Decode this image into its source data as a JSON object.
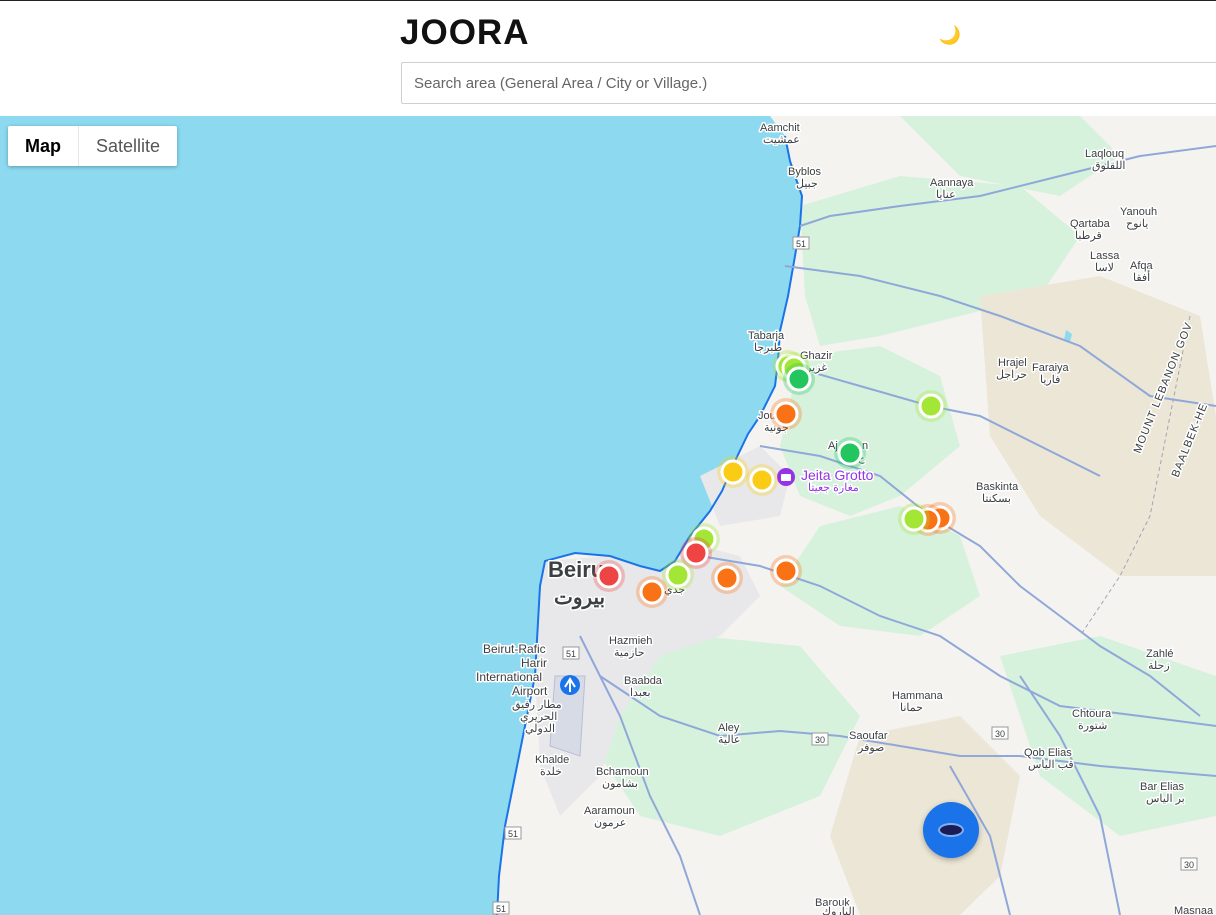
{
  "app": {
    "title": "JOORA",
    "theme_icon": "moon-icon",
    "theme_glyph": "🌙"
  },
  "search": {
    "placeholder": "Search area (General Area / City or Village.)",
    "value": ""
  },
  "map_type": {
    "map_label": "Map",
    "satellite_label": "Satellite",
    "selected": "Map"
  },
  "colors": {
    "water": "#8ddaf0",
    "land": "#f5f3f0",
    "green": "#d6f2dd",
    "urban": "#e8e8ea",
    "hills": "#ece6d6",
    "coast": "#1a73e8",
    "road": "#8fa8d8",
    "marker_red": "#ef4444",
    "marker_orange": "#f97316",
    "marker_yellow": "#facc15",
    "marker_lime": "#a3e635",
    "marker_green": "#22c55e",
    "fab": "#1a73e8"
  },
  "places": {
    "aamchit_en": "Aamchit",
    "aamchit_ar": "عمشيت",
    "byblos_en": "Byblos",
    "byblos_ar": "جبيل",
    "laqlouq_en": "Laqlouq",
    "laqlouq_ar": "اللقلوق",
    "aannaya_en": "Aannaya",
    "aannaya_ar": "عنايا",
    "qartaba_en": "Qartaba",
    "qartaba_ar": "قرطبا",
    "yanouh_en": "Yanouh",
    "yanouh_ar": "يانوح",
    "lassa_en": "Lassa",
    "lassa_ar": "لاسا",
    "afqa_en": "Afqa",
    "afqa_ar": "أفقا",
    "tabarja_en": "Tabarja",
    "tabarja_ar": "طبرجا",
    "ghazir_en": "Ghazir",
    "ghazir_ar": "غزير",
    "jounieh_en": "Jou",
    "jounieh_ar": "جونية",
    "ajaltoun_en": "Aj",
    "ajaltoun_suffix": "n",
    "ajaltoun_ar": "ع",
    "hrajel_en": "Hrajel",
    "hrajel_ar": "حراجل",
    "faraya_en": "Faraiya",
    "faraya_ar": "فاريا",
    "mlg_line1": "MOUNT LEBANON GOV",
    "mlg_line2": "BAALBEK-HE",
    "jeita_en": "Jeita Grotto",
    "jeita_ar": "مغارة جعيتا",
    "baskinta_en": "Baskinta",
    "baskinta_ar": "بسكنتا",
    "beirut_en": "Beiru",
    "beirut_ar": "بيروت",
    "jdeideh_ar": "جدي",
    "hazmieh_en": "Hazmieh",
    "hazmieh_ar": "حازمية",
    "airport_en_1": "Beirut-Rafic",
    "airport_en_2": "Harir",
    "airport_en_3": "International",
    "airport_en_4": "Airport",
    "airport_ar_1": "مطار رفيق",
    "airport_ar_2": "الحريري",
    "airport_ar_3": "الدولي",
    "baabda_en": "Baabda",
    "baabda_ar": "بعبدا",
    "zahle_en": "Zahlé",
    "zahle_ar": "زحلة",
    "hammana_en": "Hammana",
    "hammana_ar": "حمانا",
    "aley_en": "Aley",
    "aley_ar": "عالية",
    "saoufar_en": "Saoufar",
    "saoufar_ar": "صوفر",
    "chtoura_en": "Chtoura",
    "chtoura_ar": "شتورة",
    "khalde_en": "Khalde",
    "khalde_ar": "خلدة",
    "qobelias_en": "Qob Elias",
    "qobelias_ar": "قب الياس",
    "bchamoun_en": "Bchamoun",
    "bchamoun_ar": "بشامون",
    "barelias_en": "Bar Elias",
    "barelias_ar": "بر الياس",
    "aaramoun_en": "Aaramoun",
    "aaramoun_ar": "عرمون",
    "barouk_en": "Barouk",
    "barouk_ar": "الباروك",
    "masnaa_en": "Masnaa"
  },
  "road_shields": {
    "r51a": "51",
    "r51b": "51",
    "r51c": "51",
    "r51d": "51",
    "r30a": "30",
    "r30b": "30",
    "r30c": "30"
  },
  "markers": [
    {
      "status": "lime"
    },
    {
      "status": "lime"
    },
    {
      "status": "green"
    },
    {
      "status": "orange"
    },
    {
      "status": "green"
    },
    {
      "status": "lime"
    },
    {
      "status": "yellow"
    },
    {
      "status": "yellow"
    },
    {
      "status": "lime"
    },
    {
      "status": "orange"
    },
    {
      "status": "orange"
    },
    {
      "status": "lime"
    },
    {
      "status": "red"
    },
    {
      "status": "red"
    },
    {
      "status": "lime"
    },
    {
      "status": "orange"
    },
    {
      "status": "orange"
    },
    {
      "status": "orange"
    }
  ],
  "fab": {
    "icon": "locate-me-icon"
  }
}
